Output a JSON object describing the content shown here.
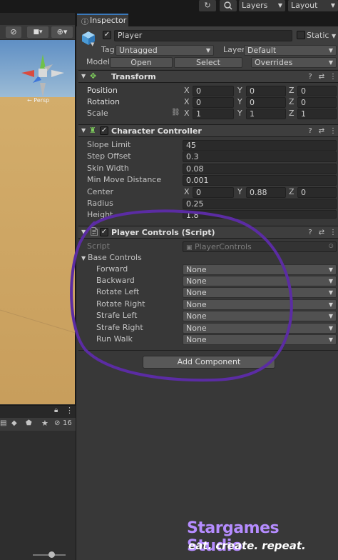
{
  "topbar": {
    "layers_label": "Layers",
    "layout_label": "Layout"
  },
  "inspector": {
    "tab_label": "Inspector",
    "object": {
      "name": "Player",
      "static_label": "Static",
      "tag_label": "Tag",
      "tag_value": "Untagged",
      "layer_label": "Layer",
      "layer_value": "Default",
      "model_label": "Model",
      "open_label": "Open",
      "select_label": "Select",
      "overrides_label": "Overrides"
    },
    "transform": {
      "title": "Transform",
      "rows": [
        {
          "label": "Position",
          "x": "0",
          "y": "0",
          "z": "0"
        },
        {
          "label": "Rotation",
          "x": "0",
          "y": "0",
          "z": "0"
        },
        {
          "label": "Scale",
          "x": "1",
          "y": "1",
          "z": "1"
        }
      ]
    },
    "character_controller": {
      "title": "Character Controller",
      "slope_limit_label": "Slope Limit",
      "slope_limit": "45",
      "step_offset_label": "Step Offset",
      "step_offset": "0.3",
      "skin_width_label": "Skin Width",
      "skin_width": "0.08",
      "min_move_label": "Min Move Distance",
      "min_move": "0.001",
      "center_label": "Center",
      "center_x": "0",
      "center_y": "0.88",
      "center_z": "0",
      "radius_label": "Radius",
      "radius": "0.25",
      "height_label": "Height",
      "height": "1.8"
    },
    "player_controls": {
      "title": "Player Controls (Script)",
      "script_label": "Script",
      "script_value": "PlayerControls",
      "group_label": "Base Controls",
      "bindings": [
        {
          "label": "Forward",
          "value": "None"
        },
        {
          "label": "Backward",
          "value": "None"
        },
        {
          "label": "Rotate Left",
          "value": "None"
        },
        {
          "label": "Rotate Right",
          "value": "None"
        },
        {
          "label": "Strafe Left",
          "value": "None"
        },
        {
          "label": "Strafe Right",
          "value": "None"
        },
        {
          "label": "Run Walk",
          "value": "None"
        }
      ]
    },
    "add_component_label": "Add Component"
  },
  "axes": {
    "x": "X",
    "y": "Y",
    "z": "Z"
  },
  "gizmo": {
    "persp_label": "← Persp"
  },
  "project": {
    "hidden_count": "16"
  },
  "watermark": {
    "title": "Stargames Studio",
    "tagline": "eat. create. repeat."
  },
  "colors": {
    "sky": "#8fb4d6",
    "ground": "#c9a15f",
    "annotation": "#5b2ca3",
    "watermark": "#b58cff"
  }
}
